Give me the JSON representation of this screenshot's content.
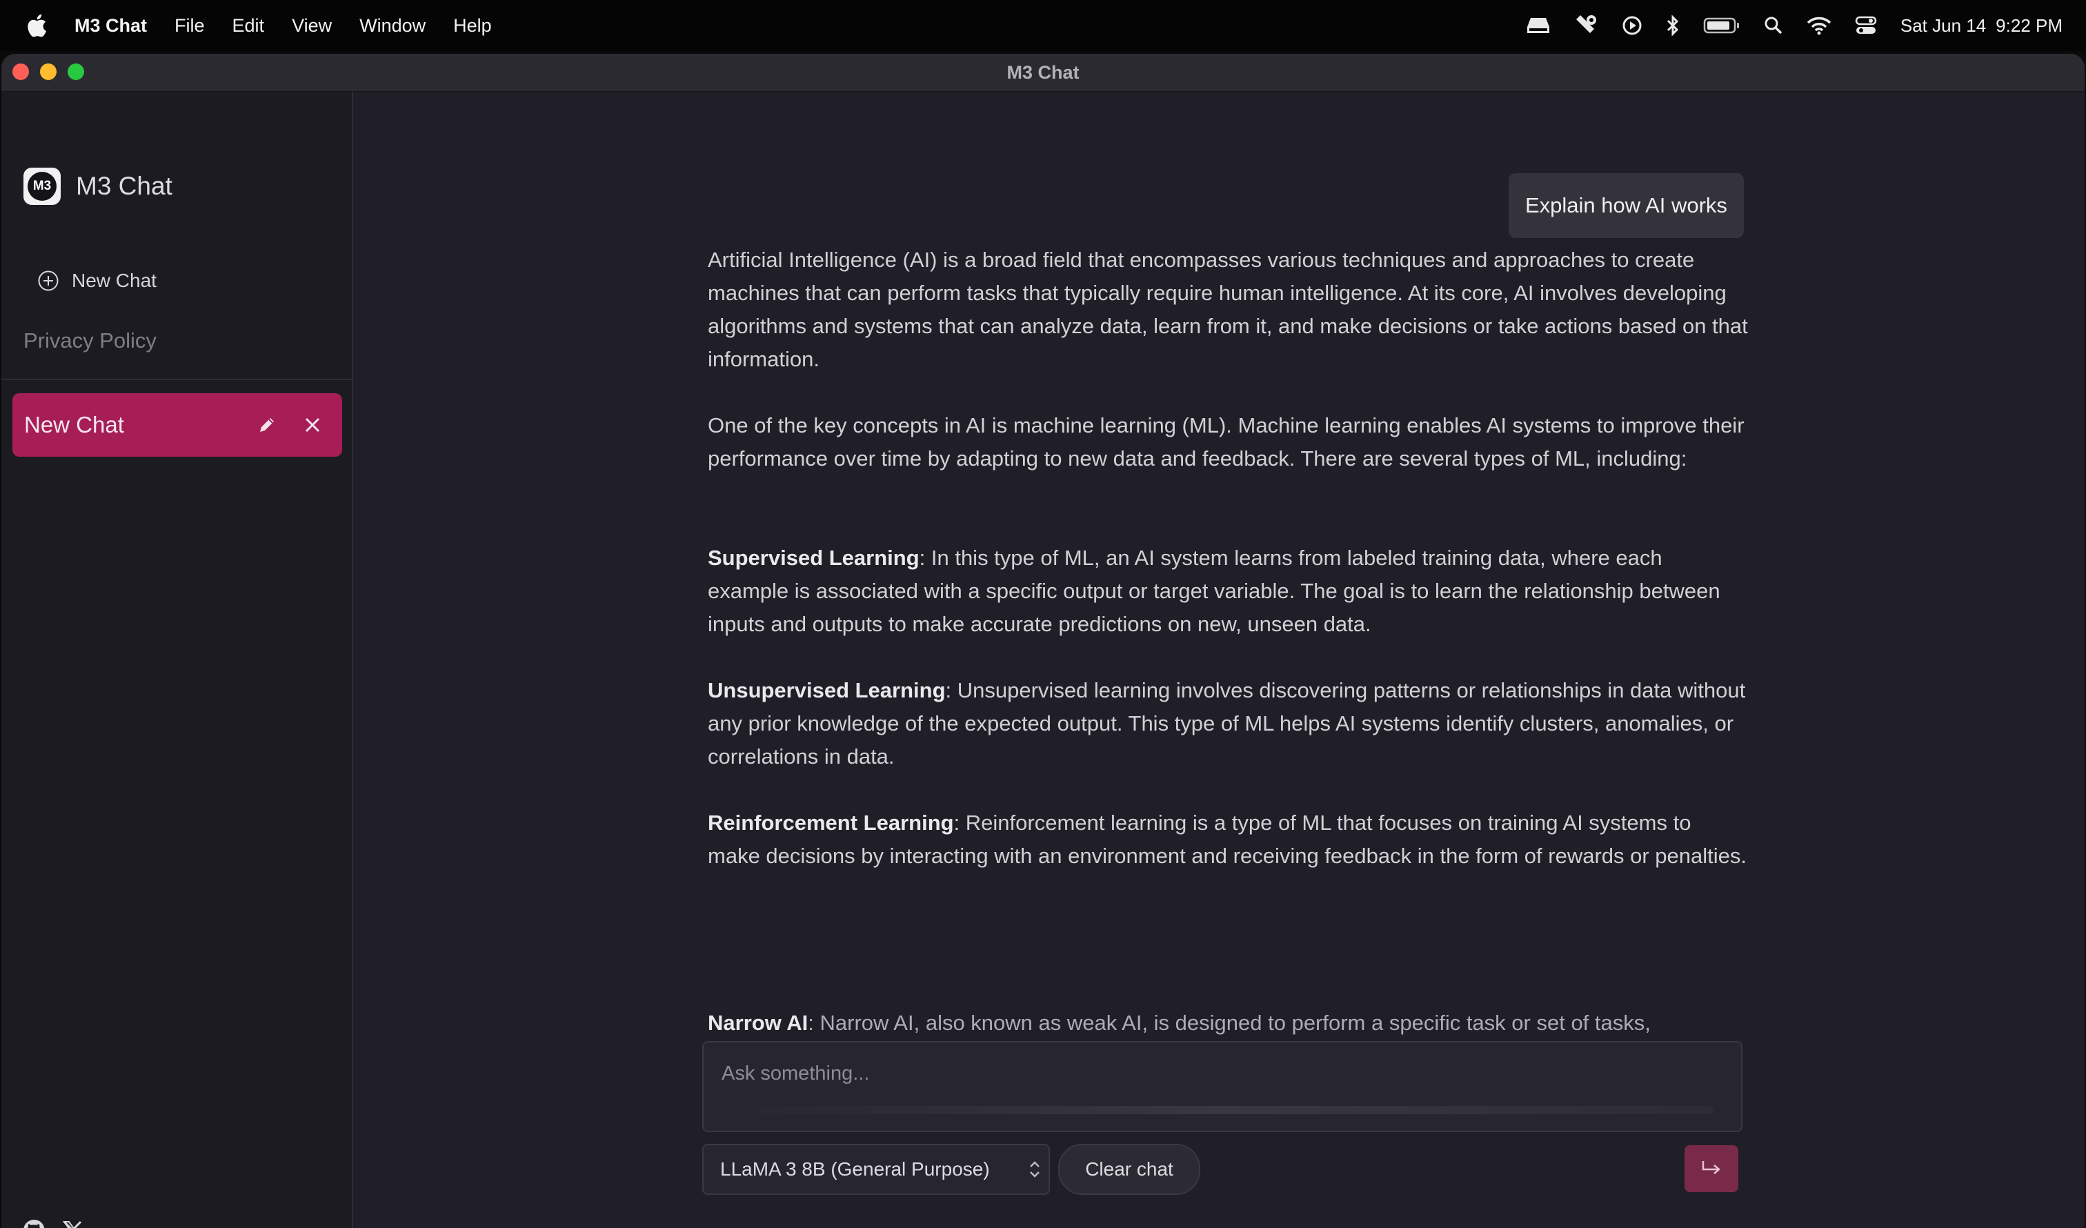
{
  "menubar": {
    "app_name": "M3 Chat",
    "items": [
      "File",
      "Edit",
      "View",
      "Window",
      "Help"
    ],
    "date": "Sat Jun 14",
    "time": "9:22 PM"
  },
  "window": {
    "title": "M3 Chat"
  },
  "sidebar": {
    "logo_text": "M3",
    "brand": "M3 Chat",
    "new_chat_label": "New Chat",
    "privacy_label": "Privacy Policy",
    "chats": [
      {
        "title": "New Chat"
      }
    ]
  },
  "conversation": {
    "user_message": "Explain how AI works",
    "answer": {
      "p1": "Artificial Intelligence (AI) is a broad field that encompasses various techniques and approaches to create machines that can perform tasks that typically require human intelligence. At its core, AI involves developing algorithms and systems that can analyze data, learn from it, and make decisions or take actions based on that information.",
      "p2": "One of the key concepts in AI is machine learning (ML). Machine learning enables AI systems to improve their performance over time by adapting to new data and feedback. There are several types of ML, including:",
      "items": [
        {
          "term": "Supervised Learning",
          "text": ": In this type of ML, an AI system learns from labeled training data, where each example is associated with a specific output or target variable. The goal is to learn the relationship between inputs and outputs to make accurate predictions on new, unseen data."
        },
        {
          "term": "Unsupervised Learning",
          "text": ": Unsupervised learning involves discovering patterns or relationships in data without any prior knowledge of the expected output. This type of ML helps AI systems identify clusters, anomalies, or correlations in data."
        },
        {
          "term": "Reinforcement Learning",
          "text": ": Reinforcement learning is a type of ML that focuses on training AI systems to make decisions by interacting with an environment and receiving feedback in the form of rewards or penalties."
        },
        {
          "term": "Narrow AI",
          "text": ": Narrow AI, also known as weak AI, is designed to perform a specific task or set of tasks,"
        }
      ]
    }
  },
  "composer": {
    "placeholder": "Ask something...",
    "model": "LLaMA 3 8B (General Purpose)",
    "clear_label": "Clear chat"
  },
  "colors": {
    "accent": "#a71e56",
    "send_button": "#7a2a49",
    "background": "#201f27",
    "sidebar": "#1c1b22"
  }
}
